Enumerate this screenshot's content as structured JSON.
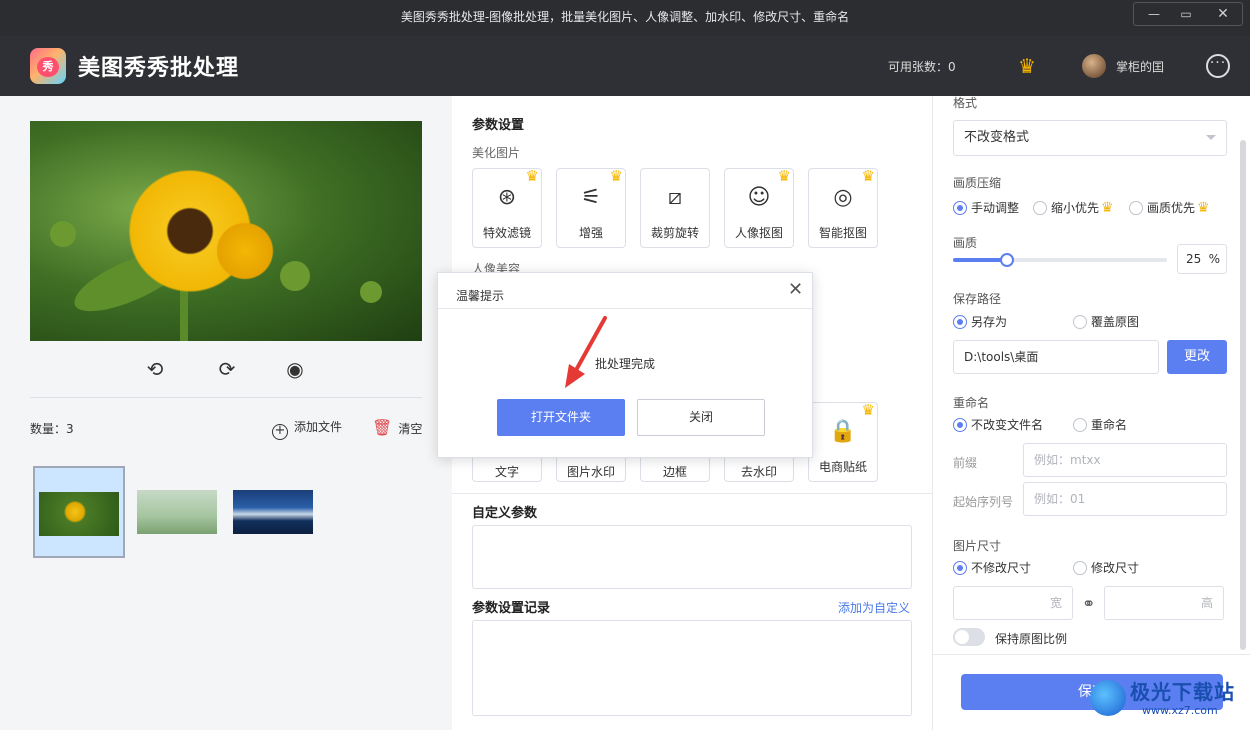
{
  "window": {
    "title": "美图秀秀批处理-图像批处理，批量美化图片、人像调整、加水印、修改尺寸、重命名",
    "minimize": "—",
    "maximize": "▭",
    "close": "✕"
  },
  "header": {
    "app_name": "美图秀秀批处理",
    "logo_text": "秀",
    "quota": "可用张数：0",
    "username": "掌柜的囯",
    "more": "···"
  },
  "left": {
    "count_label": "数量：3",
    "add_file": "添加文件",
    "clear": "清空"
  },
  "middle": {
    "params_title": "参数设置",
    "beautify_label": "美化图片",
    "beautify_cards": [
      {
        "label": "特效滤镜",
        "icon": "filter-icon",
        "vip": true
      },
      {
        "label": "增强",
        "icon": "enhance-icon",
        "vip": true
      },
      {
        "label": "裁剪旋转",
        "icon": "crop-icon",
        "vip": false
      },
      {
        "label": "人像抠图",
        "icon": "portrait-cutout-icon",
        "vip": true
      },
      {
        "label": "智能抠图",
        "icon": "smart-cutout-icon",
        "vip": true
      }
    ],
    "portrait_label": "人像美容",
    "watermark_cards": [
      {
        "label": "文字"
      },
      {
        "label": "图片水印"
      },
      {
        "label": "边框"
      },
      {
        "label": "去水印"
      },
      {
        "label": "电商贴纸",
        "icon": "sticker-icon",
        "vip": true
      }
    ],
    "custom_title": "自定义参数",
    "history_title": "参数设置记录",
    "add_custom_link": "添加为自定义"
  },
  "right": {
    "format_label": "格式",
    "format_value": "不改变格式",
    "compress_label": "画质压缩",
    "compress_options": [
      "手动调整",
      "缩小优先",
      "画质优先"
    ],
    "quality_label": "画质",
    "quality_value": "25",
    "quality_unit": "%",
    "quality_level": 0.25,
    "save_path_label": "保存路径",
    "save_options": [
      "另存为",
      "覆盖原图"
    ],
    "path_value": "D:\\tools\\桌面",
    "change_button": "更改",
    "rename_label": "重命名",
    "rename_options": [
      "不改变文件名",
      "重命名"
    ],
    "prefix_label": "前缀",
    "prefix_placeholder": "例如：mtxx",
    "start_label": "起始序列号",
    "start_placeholder": "例如：01",
    "size_label": "图片尺寸",
    "size_options": [
      "不修改尺寸",
      "修改尺寸"
    ],
    "width_placeholder": "宽",
    "height_placeholder": "高",
    "keep_ratio": "保持原图比例",
    "save_button": "保存"
  },
  "dialog": {
    "title": "温馨提示",
    "close": "✕",
    "message": "批处理完成",
    "primary": "打开文件夹",
    "secondary": "关闭"
  },
  "watermark": {
    "main": "极光下载站",
    "url": "www.xz7.com"
  },
  "colors": {
    "accent": "#5b7ff0",
    "vip_crown": "#f7b500",
    "header_bg": "#2f3035"
  }
}
